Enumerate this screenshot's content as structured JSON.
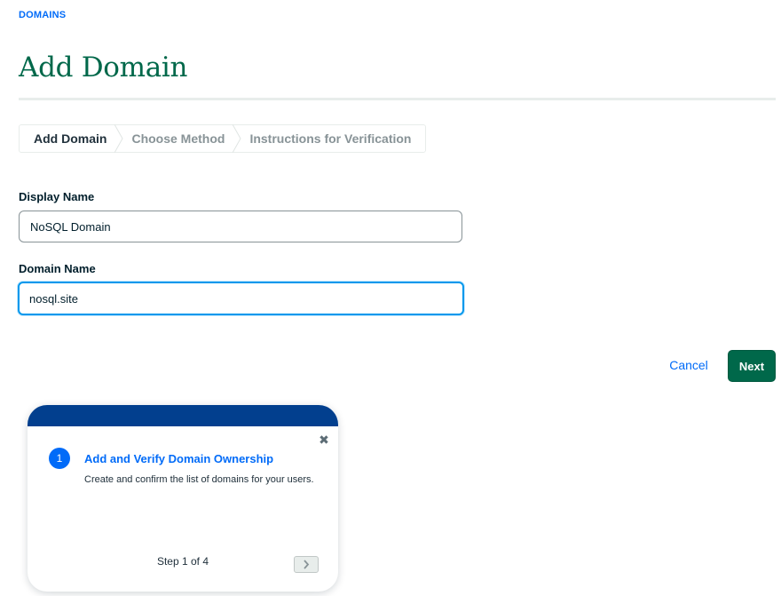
{
  "breadcrumb": {
    "label": "DOMAINS"
  },
  "page": {
    "title": "Add Domain"
  },
  "stepper": {
    "steps": [
      {
        "label": "Add Domain",
        "active": true
      },
      {
        "label": "Choose Method",
        "active": false
      },
      {
        "label": "Instructions for Verification",
        "active": false
      }
    ]
  },
  "form": {
    "display_name": {
      "label": "Display Name",
      "value": "NoSQL Domain"
    },
    "domain_name": {
      "label": "Domain Name",
      "value": "nosql.site"
    }
  },
  "actions": {
    "cancel_label": "Cancel",
    "next_label": "Next"
  },
  "guide": {
    "step_number": "1",
    "title": "Add and Verify Domain Ownership",
    "description": "Create and confirm the list of domains for your users.",
    "counter": "Step 1 of 4",
    "close_icon": "close-icon",
    "next_icon": "chevron-right-icon"
  },
  "colors": {
    "brand_green": "#00684a",
    "link_blue": "#016bf8",
    "guide_header": "#023f8e",
    "focus_ring": "#0498ec"
  }
}
